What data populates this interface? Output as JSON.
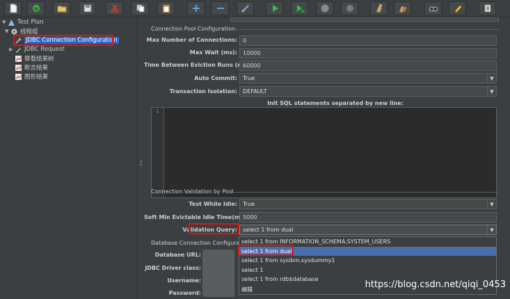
{
  "toolbar": {
    "buttons": [
      "new-icon",
      "template-icon",
      "open-icon",
      "save-icon",
      "cut-icon",
      "copy-icon",
      "paste-icon",
      "expand-icon",
      "collapse-icon",
      "toggle-icon",
      "start-icon",
      "start-no-pause-icon",
      "stop-icon",
      "shutdown-icon",
      "clear-icon",
      "clear-all-icon",
      "search-icon",
      "reset-search-icon",
      "function-helper-icon"
    ]
  },
  "tree": {
    "root": "Test Plan",
    "thread_group": "线程组",
    "selected": "JDBC Connection Configuration",
    "request": "JDBC Request",
    "listeners": [
      "察看结果树",
      "断言结果",
      "图形结果"
    ]
  },
  "pool": {
    "title": "Connection Pool Configuration",
    "max_connections_label": "Max Number of Connections:",
    "max_connections": "0",
    "max_wait_label": "Max Wait (ms):",
    "max_wait": "10000",
    "eviction_label": "Time Between Eviction Runs (ms):",
    "eviction": "60000",
    "auto_commit_label": "Auto Commit:",
    "auto_commit": "True",
    "isolation_label": "Transaction Isolation:",
    "isolation": "DEFAULT",
    "init_sql_label": "Init SQL statements separated by new line:",
    "line_number": "1"
  },
  "validation": {
    "title": "Connection Validation by Pool",
    "test_idle_label": "Test While Idle:",
    "test_idle": "True",
    "soft_min_label": "Soft Min Evictable Idle Time(ms):",
    "soft_min": "5000",
    "query_label": "Validation Query:",
    "query": "select 1 from dual",
    "options": [
      "select 1 from INFORMATION_SCHEMA.SYSTEM_USERS",
      "select 1 from dual",
      "select 1 from sysibm.sysdummy1",
      "select 1",
      "select 1 from rdb$database",
      "编辑"
    ],
    "highlighted_index": 1
  },
  "database": {
    "title": "Database Connection Configurat",
    "url_label": "Database URL:",
    "driver_label": "JDBC Driver class:",
    "username_label": "Username:",
    "password_label": "Password:"
  },
  "watermark": "https://blog.csdn.net/qiqi_0453"
}
